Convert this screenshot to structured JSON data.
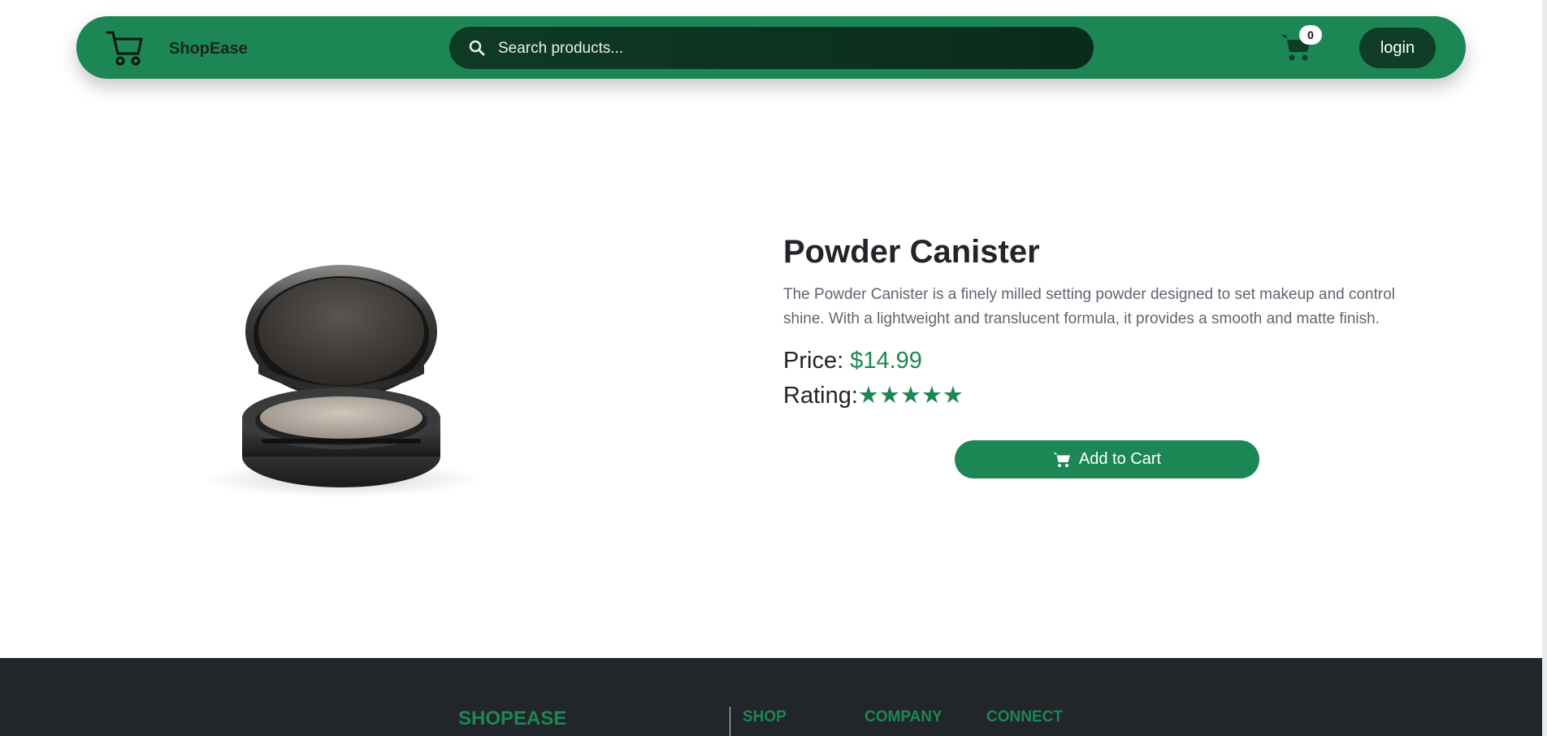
{
  "header": {
    "brand": "ShopEase",
    "search_placeholder": "Search products...",
    "cart_count": "0",
    "login_label": "login"
  },
  "product": {
    "title": "Powder Canister",
    "description": "The Powder Canister is a finely milled setting powder designed to set makeup and control shine. With a lightweight and translucent formula, it provides a smooth and matte finish.",
    "price_label": "Price:",
    "price_value": "$14.99",
    "rating_label": "Rating:",
    "rating_stars": "★★★★★",
    "rating_value": 5,
    "add_to_cart_label": "Add to Cart"
  },
  "footer": {
    "brand": "SHOPEASE",
    "columns": [
      "SHOP",
      "COMPANY",
      "CONNECT"
    ]
  },
  "colors": {
    "accent": "#1c8754",
    "dark_pill": "#0f3d28",
    "footer_bg": "#22252a"
  },
  "icons": [
    "cart-logo-icon",
    "search-icon",
    "cart-icon",
    "shopping-cart-icon"
  ]
}
